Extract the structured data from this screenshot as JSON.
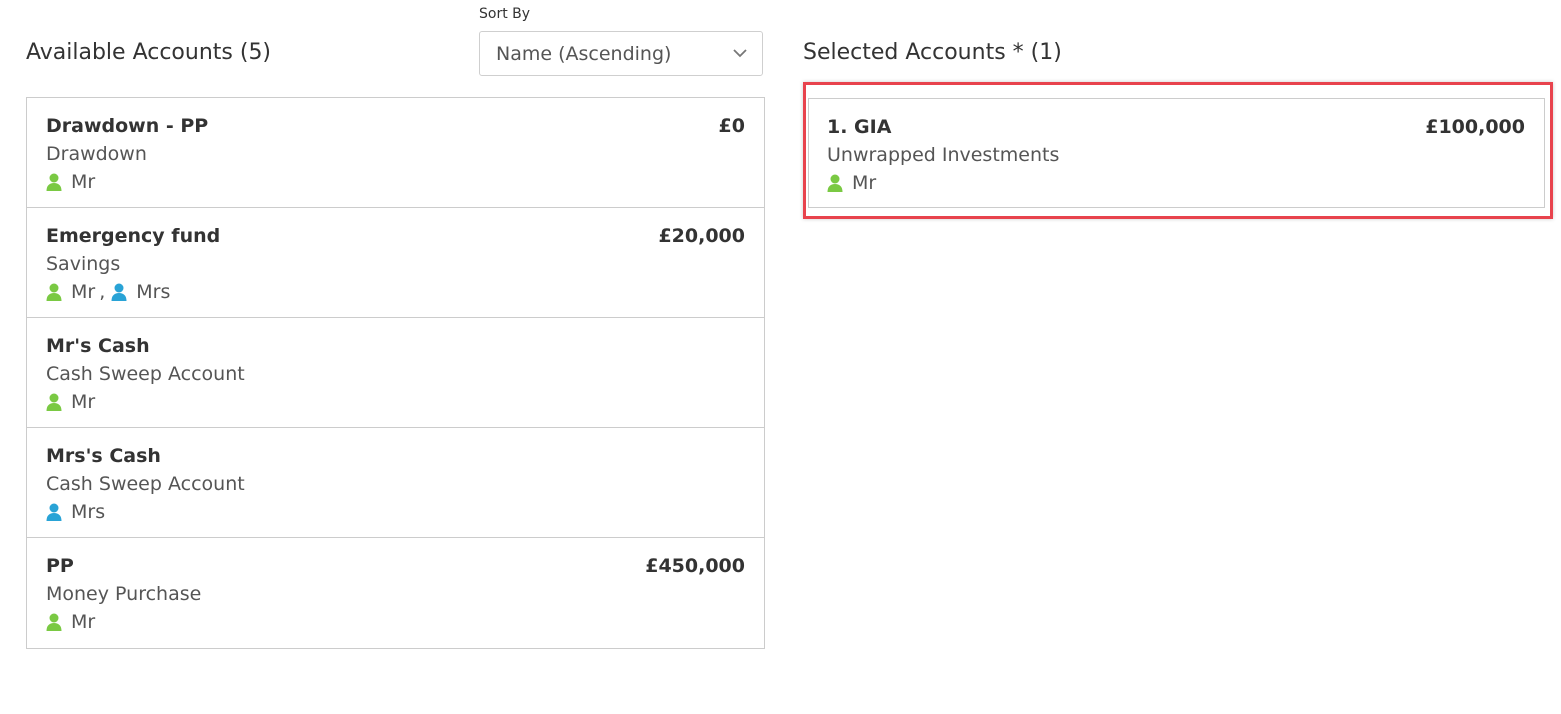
{
  "sort": {
    "label": "Sort By",
    "selected": "Name (Ascending)"
  },
  "available": {
    "heading": "Available Accounts (5)",
    "accounts": [
      {
        "name": "Drawdown - PP",
        "type": "Drawdown",
        "value": "£0",
        "owners": [
          {
            "name": "Mr",
            "color": "#7ac943"
          }
        ]
      },
      {
        "name": "Emergency fund",
        "type": "Savings",
        "value": "£20,000",
        "owners": [
          {
            "name": "Mr",
            "color": "#7ac943"
          },
          {
            "name": "Mrs",
            "color": "#29a3d6"
          }
        ]
      },
      {
        "name": "Mr's Cash",
        "type": "Cash Sweep Account",
        "value": "",
        "owners": [
          {
            "name": "Mr",
            "color": "#7ac943"
          }
        ]
      },
      {
        "name": "Mrs's Cash",
        "type": "Cash Sweep Account",
        "value": "",
        "owners": [
          {
            "name": "Mrs",
            "color": "#29a3d6"
          }
        ]
      },
      {
        "name": "PP",
        "type": "Money Purchase",
        "value": "£450,000",
        "owners": [
          {
            "name": "Mr",
            "color": "#7ac943"
          }
        ]
      }
    ]
  },
  "selected": {
    "heading": "Selected Accounts * (1)",
    "accounts": [
      {
        "name": "1. GIA",
        "type": "Unwrapped Investments",
        "value": "£100,000",
        "owners": [
          {
            "name": "Mr",
            "color": "#7ac943"
          }
        ]
      }
    ]
  },
  "owner_separator": ",",
  "icons": {
    "owner": "person-icon",
    "dropdown": "chevron-down-icon"
  },
  "colors": {
    "highlight_border": "#e8434d",
    "mr": "#7ac943",
    "mrs": "#29a3d6"
  }
}
